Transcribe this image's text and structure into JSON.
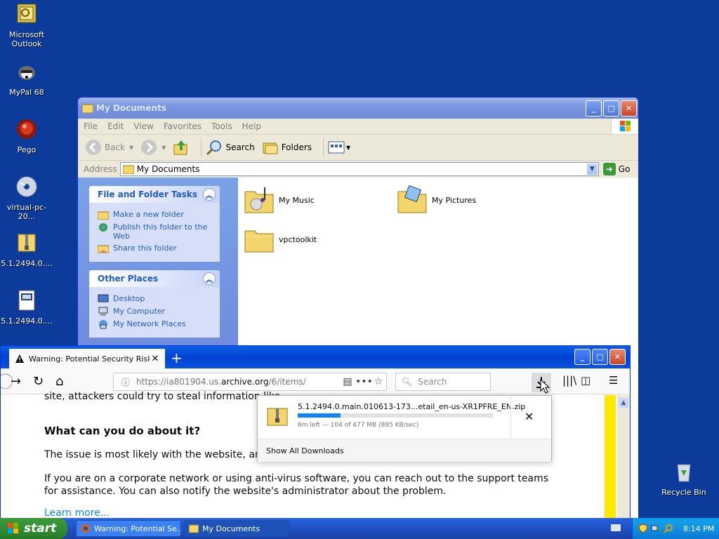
{
  "desktop": {
    "icons": [
      {
        "label": "Microsoft Outlook"
      },
      {
        "label": "MyPal 68"
      },
      {
        "label": "Pego"
      },
      {
        "label": "virtual-pc-20..."
      },
      {
        "label": "5.1.2494.0...."
      },
      {
        "label": "5.1.2494.0...."
      },
      {
        "label": "Recycle Bin"
      }
    ]
  },
  "explorer": {
    "title": "My Documents",
    "menu": [
      "File",
      "Edit",
      "View",
      "Favorites",
      "Tools",
      "Help"
    ],
    "toolbar": {
      "back": "Back",
      "search": "Search",
      "folders": "Folders"
    },
    "address_label": "Address",
    "address_value": "My Documents",
    "go_label": "Go",
    "file_tasks": {
      "title": "File and Folder Tasks",
      "items": [
        "Make a new folder",
        "Publish this folder to the Web",
        "Share this folder"
      ]
    },
    "other_places": {
      "title": "Other Places",
      "items": [
        "Desktop",
        "My Computer",
        "My Network Places"
      ]
    },
    "files": [
      {
        "name": "My Music"
      },
      {
        "name": "My Pictures"
      },
      {
        "name": "vpctoolkit"
      }
    ]
  },
  "firefox": {
    "tab_title": "Warning: Potential Security Risk Ah",
    "url_prefix": "https://ia801904.us.",
    "url_domain": "archive.org",
    "url_suffix": "/6/items/",
    "search_placeholder": "Search",
    "content": {
      "cut_text": "site, attackers could try to steal information like",
      "heading": "What can you do about it?",
      "p1": "The issue is most likely with the website, and t",
      "p2": "If you are on a corporate network or using anti-virus software, you can reach out to the support teams for assistance. You can also notify the website's administrator about the problem.",
      "learn_more": "Learn more..."
    },
    "download": {
      "filename": "5.1.2494.0.main.010613-173...etail_en-us-XR1PFRE_EN.zip",
      "status": "6m left — 104 of 477 MB (895 KB/sec)",
      "progress": 0.22,
      "show_all": "Show All Downloads"
    }
  },
  "taskbar": {
    "start": "start",
    "buttons": [
      "Warning: Potential Se...",
      "My Documents"
    ],
    "clock": "8:14 PM"
  }
}
